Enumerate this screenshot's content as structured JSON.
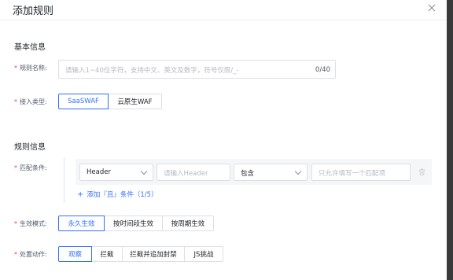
{
  "dialog": {
    "title": "添加规则"
  },
  "basic": {
    "section_title": "基本信息",
    "name_label": "规则名称:",
    "name_placeholder": "请输入1~40位字符，支持中文、英文及数字，符号仅限/_-",
    "name_count": "0/40",
    "access_label": "接入类型:",
    "access_options": [
      "SaaSWAF",
      "云原生WAF"
    ],
    "access_selected": "SaaSWAF"
  },
  "rule": {
    "section_title": "规则信息",
    "match_label": "匹配条件:",
    "match_field": "Header",
    "match_field_placeholder": "请输入Header",
    "match_operator": "包含",
    "match_value_placeholder": "只允许填写一个匹配项",
    "add_condition": "添加『且』条件（1/5）",
    "effect_label": "生效模式:",
    "effect_options": [
      "永久生效",
      "按时间段生效",
      "按周期生效"
    ],
    "effect_selected": "永久生效",
    "action_label": "处置动作:",
    "action_options": [
      "观察",
      "拦截",
      "拦截并追加封禁",
      "JS挑战"
    ],
    "action_selected": "观察"
  },
  "colors": {
    "accent": "#3370ff",
    "required": "#f53f3f"
  },
  "icons": [
    "close-icon",
    "chevron-down-icon",
    "trash-icon",
    "plus-icon"
  ]
}
